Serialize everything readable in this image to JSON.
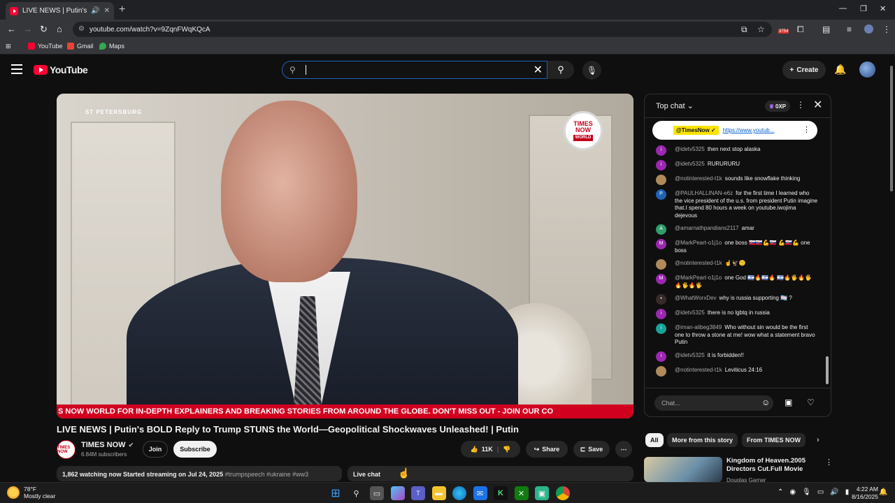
{
  "browser": {
    "tab_title": "LIVE NEWS | Putin's BOLD R",
    "url": "youtube.com/watch?v=9ZqnFWqKQcA",
    "extension_badge": "3754",
    "bookmarks": [
      {
        "label": "YouTube",
        "color": "#ff0033"
      },
      {
        "label": "Gmail",
        "color": "#ea4335"
      },
      {
        "label": "Maps",
        "color": "#34a853"
      }
    ]
  },
  "youtube": {
    "logo_text": "YouTube",
    "search_value": "",
    "create_label": "Create"
  },
  "player": {
    "location_watermark": "ST PETERSBURG",
    "channel_logo_line1": "TIMES",
    "channel_logo_line2": "NOW",
    "channel_logo_line3": "WORLD",
    "ticker_text": "S NOW WORLD FOR IN-DEPTH EXPLAINERS AND BREAKING STORIES FROM AROUND THE GLOBE. DON'T MISS OUT - JOIN OUR CO"
  },
  "video": {
    "title": "LIVE NEWS | Putin's BOLD Reply to Trump STUNS the World—Geopolitical Shockwaves Unleashed! | Putin",
    "channel_name": "TIMES NOW",
    "channel_avatar_text": "TIMES NOW",
    "subscribers": "6.84M subscribers",
    "join_label": "Join",
    "subscribe_label": "Subscribe",
    "likes": "11K",
    "share_label": "Share",
    "save_label": "Save",
    "watching": "1,862 watching now",
    "started": "Started streaming on Jul 24, 2025",
    "tags": "#trumpspeech #ukraine #ww3",
    "live_chat_label": "Live chat"
  },
  "chat": {
    "mode_label": "Top chat",
    "xp_label": "0XP",
    "pinned_author": "@TimesNow ✓",
    "pinned_link": "https://www.youtub...",
    "input_placeholder": "Chat...",
    "messages": [
      {
        "author": "@idetv5325",
        "text": "then next stop alaska",
        "avatar": "i",
        "color": "#9c27b0"
      },
      {
        "author": "@idetv5325",
        "text": "RURURURU",
        "avatar": "i",
        "color": "#9c27b0"
      },
      {
        "author": "@notinterested-t1k",
        "text": "sounds like snowflake thinking",
        "avatar": "",
        "color": "#b08a5a"
      },
      {
        "author": "@PAULHALLINAN-e6z",
        "text": "for the first time I learned who the vice president of the u.s. from president Putin imagine that.I spend 80 hours a week on youtube.iwojima dejevous",
        "avatar": "P",
        "color": "#1e63b5"
      },
      {
        "author": "@amarnathpandians2117",
        "text": "amar",
        "avatar": "A",
        "color": "#2e9e6e"
      },
      {
        "author": "@MarkPeart-o1j1o",
        "text": "one boss 🇸🇰🇸🇰💪🇸🇰 💪🇸🇰💪 one boss",
        "avatar": "M",
        "color": "#9c27b0"
      },
      {
        "author": "@notinterested-t1k",
        "text": "☝️🦅😗",
        "avatar": "",
        "color": "#b08a5a"
      },
      {
        "author": "@MarkPeart-o1j1o",
        "text": "one God 🇮🇱🔥🇮🇱🔥 🇮🇱🔥🖐🔥🖐🔥🖐🔥🖐",
        "avatar": "M",
        "color": "#9c27b0"
      },
      {
        "author": "@WhatWorxDev",
        "text": "why is russia supporting 🏳️‍⚧️ ?",
        "avatar": "•",
        "color": "#3a2a2a"
      },
      {
        "author": "@idetv5325",
        "text": "there is no lgbtq in russia",
        "avatar": "i",
        "color": "#9c27b0"
      },
      {
        "author": "@iman-alibeg3849",
        "text": "Who without sin would be the first one to throw a stone at me! wow what a statement bravo Putin",
        "avatar": "i",
        "color": "#17a39a"
      },
      {
        "author": "@idetv5325",
        "text": "it is forbidden!!",
        "avatar": "i",
        "color": "#9c27b0"
      },
      {
        "author": "@notinterested-t1k",
        "text": "Leviticus 24:16",
        "avatar": "",
        "color": "#b08a5a"
      }
    ]
  },
  "chips": [
    "All",
    "More from this story",
    "From TIMES NOW"
  ],
  "recommendation": {
    "title": "Kingdom of Heaven.2005 Directors Cut.Full Movie",
    "channel": "Douglas Garner"
  },
  "taskbar": {
    "temperature": "78°F",
    "weather": "Mostly clear",
    "time": "4:22 AM",
    "date": "8/16/2025"
  }
}
